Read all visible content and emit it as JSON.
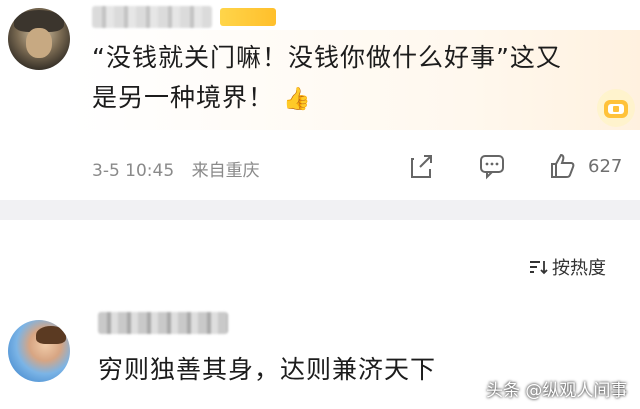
{
  "comment1": {
    "text_line1": "“没钱就关门嘛！没钱你做什么好事”这又",
    "text_line2": "是另一种境界！",
    "emoji": "👍",
    "date": "3-5 10:45",
    "location": "来自重庆",
    "like_count": "627"
  },
  "sort": {
    "label": "按热度"
  },
  "comment2": {
    "text": "穷则独善其身，达则兼济天下"
  },
  "watermark": "头条 @纵观人间事",
  "colors": {
    "divider": "#f1f1f3",
    "meta": "#8a8a8a",
    "vip": "#ffc23a"
  }
}
